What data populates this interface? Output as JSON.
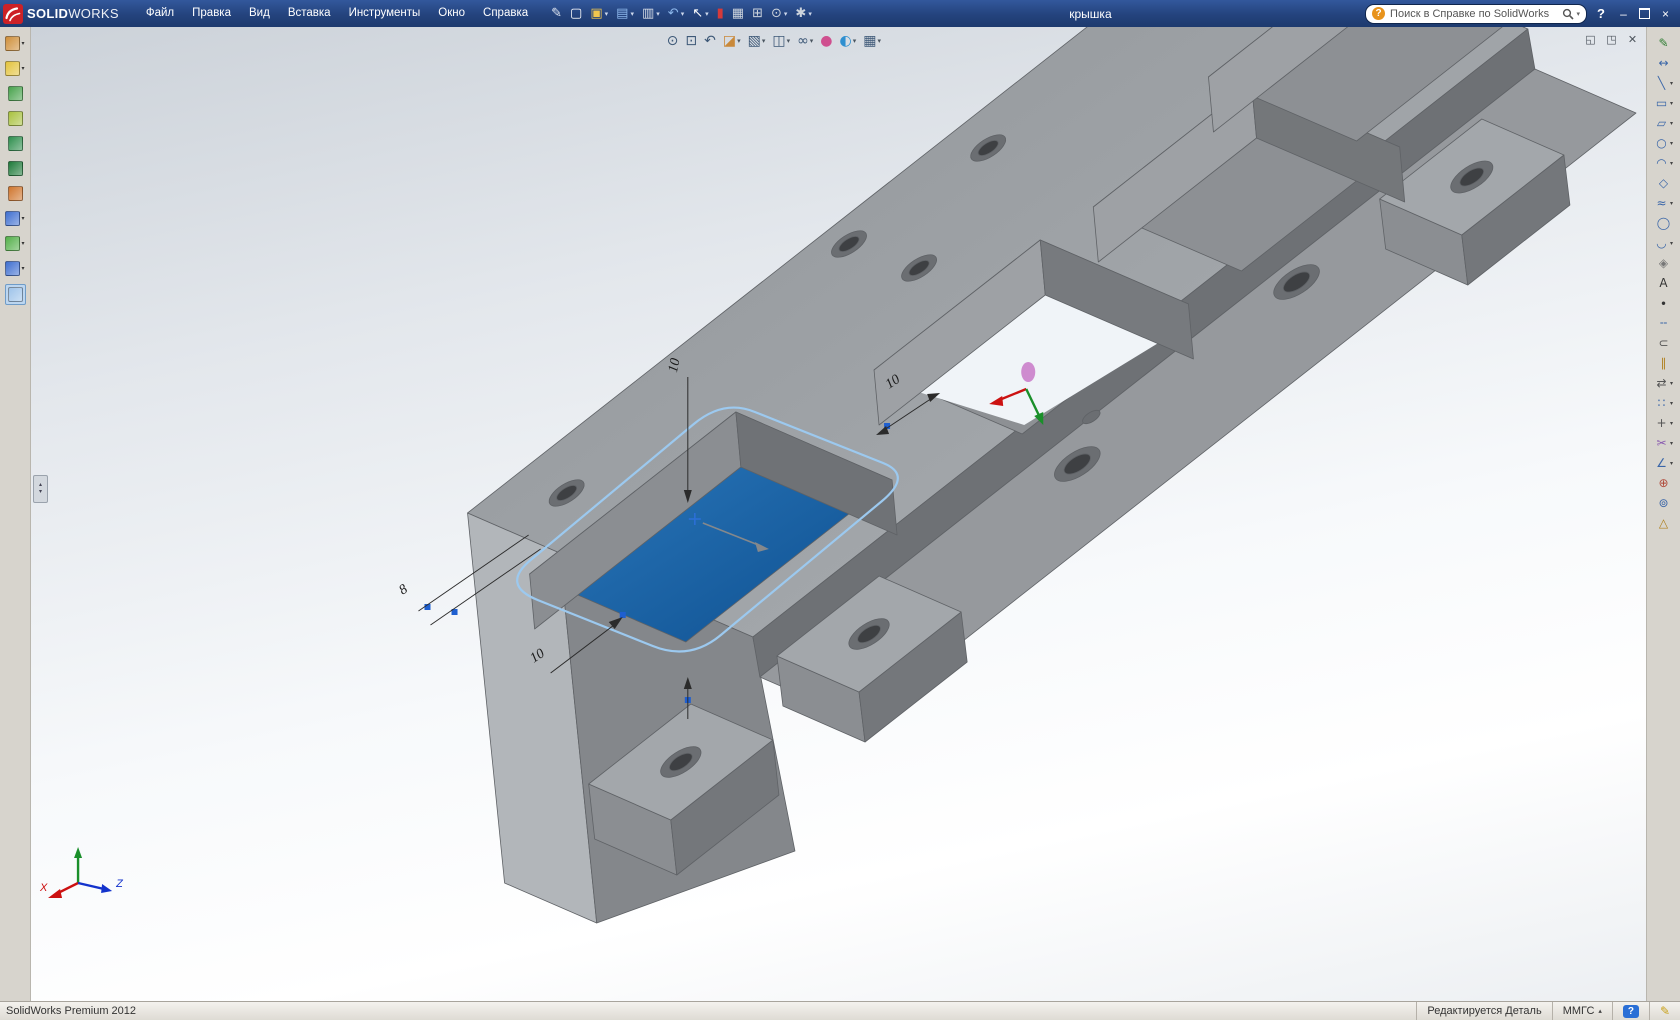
{
  "window": {
    "app_name_bold": "SOLID",
    "app_name_light": "WORKS",
    "document_title": "крышка",
    "minimize_glyph": "–",
    "close_glyph": "×"
  },
  "menu": {
    "items": [
      {
        "name": "file",
        "label": "Файл"
      },
      {
        "name": "edit",
        "label": "Правка"
      },
      {
        "name": "view",
        "label": "Вид"
      },
      {
        "name": "insert",
        "label": "Вставка"
      },
      {
        "name": "tools",
        "label": "Инструменты"
      },
      {
        "name": "window",
        "label": "Окно"
      },
      {
        "name": "help",
        "label": "Справка"
      }
    ]
  },
  "main_toolbar": {
    "buttons": [
      {
        "name": "quick-capture",
        "glyph": "✎",
        "color": "#dfe6f2"
      },
      {
        "name": "new-document",
        "glyph": "▢",
        "color": "#ffffff"
      },
      {
        "name": "open-document",
        "glyph": "▣",
        "color": "#f0c64e",
        "caret": true
      },
      {
        "name": "save",
        "glyph": "▤",
        "color": "#8db8ec",
        "caret": true
      },
      {
        "name": "print",
        "glyph": "▥",
        "color": "#d7dde6",
        "caret": true
      },
      {
        "name": "undo",
        "glyph": "↶",
        "color": "#8db8ec",
        "caret": true
      },
      {
        "name": "select",
        "glyph": "↖",
        "color": "#ffffff",
        "caret": true
      },
      {
        "name": "stop",
        "glyph": "▮",
        "color": "#d63a3a"
      },
      {
        "name": "file-properties",
        "glyph": "▦",
        "color": "#ccd3dc"
      },
      {
        "name": "insert-table",
        "glyph": "⊞",
        "color": "#ccd3dc"
      },
      {
        "name": "measure",
        "glyph": "⊙",
        "color": "#ccd3dc",
        "caret": true
      },
      {
        "name": "options",
        "glyph": "✱",
        "color": "#ccd3dc",
        "caret": true
      }
    ]
  },
  "search": {
    "placeholder": "Поиск в Справке по SolidWorks",
    "help_badge": "?"
  },
  "headsup_toolbar": {
    "buttons": [
      {
        "name": "zoom-to-fit",
        "glyph": "⊙",
        "color": "#3d5877"
      },
      {
        "name": "zoom-to-area",
        "glyph": "⊡",
        "color": "#3d5877"
      },
      {
        "name": "previous-view",
        "glyph": "↶",
        "color": "#3d5877"
      },
      {
        "name": "section-view",
        "glyph": "◪",
        "color": "#c9893a",
        "caret": true
      },
      {
        "name": "view-orientation",
        "glyph": "▧",
        "color": "#3d5877",
        "caret": true
      },
      {
        "name": "display-style",
        "glyph": "◫",
        "color": "#3d5877",
        "caret": true
      },
      {
        "name": "hide-show-items",
        "glyph": "∞",
        "color": "#3d5877",
        "caret": true
      },
      {
        "name": "edit-appearance",
        "glyph": "●",
        "color": "#cf4f8f"
      },
      {
        "name": "apply-scene",
        "glyph": "◐",
        "color": "#2e8fd0",
        "caret": true
      },
      {
        "name": "view-settings",
        "glyph": "▦",
        "color": "#3d5877",
        "caret": true
      }
    ]
  },
  "left_toolbar": {
    "buttons": [
      {
        "name": "screen-capture",
        "color": "#cf8f3a",
        "caret": true
      },
      {
        "name": "new-window",
        "color": "#e3c33c",
        "caret": true
      },
      {
        "name": "part-template",
        "color": "#49a34d"
      },
      {
        "name": "assembly-template",
        "color": "#a9c23f"
      },
      {
        "name": "drawing-template",
        "color": "#2f8f4e"
      },
      {
        "name": "publish-edrawings",
        "color": "#1f7a3a"
      },
      {
        "name": "pack-and-go",
        "color": "#d0762e"
      },
      {
        "name": "selection-filter",
        "color": "#3f6fd0",
        "caret": true
      },
      {
        "name": "smart-select",
        "color": "#54b04a",
        "caret": true
      },
      {
        "name": "spline-tools",
        "color": "#3f6fd0",
        "caret": true
      },
      {
        "name": "active-sketch-tool",
        "color": "#9fc4ea",
        "active": true
      }
    ]
  },
  "right_toolbar": {
    "buttons": [
      {
        "name": "sketch",
        "glyph": "✎",
        "color": "#2e7d32"
      },
      {
        "name": "smart-dimension",
        "glyph": "↔",
        "color": "#3a66a8"
      },
      {
        "name": "line",
        "glyph": "╲",
        "color": "#3a66a8",
        "caret": true
      },
      {
        "name": "corner-rectangle",
        "glyph": "▭",
        "color": "#3a66a8",
        "caret": true
      },
      {
        "name": "straight-slot",
        "glyph": "▱",
        "color": "#3a66a8",
        "caret": true
      },
      {
        "name": "circle",
        "glyph": "○",
        "color": "#3a66a8",
        "caret": true
      },
      {
        "name": "centerpoint-arc",
        "glyph": "◠",
        "color": "#3a66a8",
        "caret": true
      },
      {
        "name": "polygon",
        "glyph": "◇",
        "color": "#3a66a8"
      },
      {
        "name": "spline",
        "glyph": "≈",
        "color": "#3a66a8",
        "caret": true
      },
      {
        "name": "ellipse",
        "glyph": "◯",
        "color": "#3a66a8"
      },
      {
        "name": "sketch-fillet",
        "glyph": "◡",
        "color": "#3a66a8",
        "caret": true
      },
      {
        "name": "plane",
        "glyph": "◈",
        "color": "#777777"
      },
      {
        "name": "text",
        "glyph": "A",
        "color": "#333333"
      },
      {
        "name": "point",
        "glyph": "∙",
        "color": "#333333"
      },
      {
        "name": "centerline",
        "glyph": "╌",
        "color": "#3a66a8"
      },
      {
        "name": "convert-entities",
        "glyph": "⊂",
        "color": "#555555"
      },
      {
        "name": "offset-entities",
        "glyph": "∥",
        "color": "#b0801f"
      },
      {
        "name": "mirror-entities",
        "glyph": "⇄",
        "color": "#555555",
        "caret": true
      },
      {
        "name": "linear-sketch-pattern",
        "glyph": "∷",
        "color": "#3a66a8",
        "caret": true
      },
      {
        "name": "move-entities",
        "glyph": "+",
        "color": "#555555",
        "caret": true
      },
      {
        "name": "trim-entities",
        "glyph": "✂",
        "color": "#8a5cb0",
        "caret": true
      },
      {
        "name": "display-relations",
        "glyph": "∠",
        "color": "#3a66a8",
        "caret": true
      },
      {
        "name": "repair-sketch",
        "glyph": "⊕",
        "color": "#b04a3a"
      },
      {
        "name": "rapid-sketch",
        "glyph": "⊚",
        "color": "#3a66a8"
      },
      {
        "name": "instant-2d",
        "glyph": "△",
        "color": "#b0801f"
      }
    ]
  },
  "viewport": {
    "dimensions": {
      "d1": "10",
      "d2": "10",
      "d3": "10",
      "d4": "8"
    },
    "triad": {
      "x_label": "X",
      "z_label": "Z"
    }
  },
  "status_bar": {
    "product": "SolidWorks Premium 2012",
    "editing_status": "Редактируется Деталь",
    "units": "ММГС",
    "help_badge": "?",
    "tool_glyph": "✎"
  }
}
